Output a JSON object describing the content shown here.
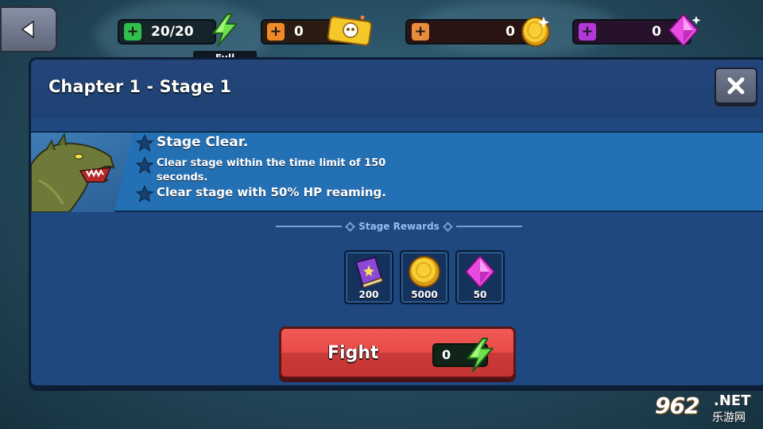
{
  "top_bar": {
    "energy": {
      "value": "20/20",
      "status": "Full"
    },
    "tickets": {
      "value": "0"
    },
    "coins": {
      "value": "0"
    },
    "gems": {
      "value": "0"
    }
  },
  "dialog": {
    "title": "Chapter 1 - Stage 1",
    "objectives": [
      "Stage Clear.",
      "Clear stage within the time limit of 150 seconds.",
      "Clear stage with 50% HP reaming."
    ],
    "rewards_title": "Stage Rewards",
    "rewards": [
      {
        "icon": "book-icon",
        "amount": "200"
      },
      {
        "icon": "coin-icon",
        "amount": "5000"
      },
      {
        "icon": "gem-icon",
        "amount": "50"
      }
    ],
    "fight": {
      "label": "Fight",
      "cost": "0"
    }
  },
  "watermark": {
    "number": "962",
    "suffix": ".NET",
    "text": "乐游网"
  },
  "colors": {
    "dialog_bg": "#1f4780",
    "panel_bg": "#2470b4",
    "fight_red": "#e84a47",
    "energy_green": "#2fbf4a",
    "coin_gold": "#f5c52a",
    "gem_pink": "#e84be0"
  }
}
